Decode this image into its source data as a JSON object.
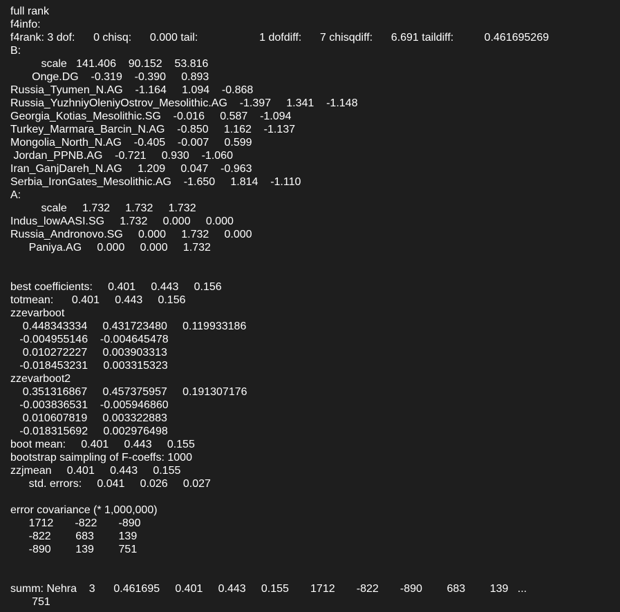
{
  "lines": [
    "full rank",
    "f4info:",
    "f4rank: 3 dof:      0 chisq:      0.000 tail:                    1 dofdiff:      7 chisqdiff:      6.691 taildiff:          0.461695269",
    "B:",
    "          scale   141.406    90.152    53.816",
    "       Onge.DG    -0.319    -0.390     0.893",
    "Russia_Tyumen_N.AG    -1.164     1.094    -0.868",
    "Russia_YuzhniyOleniyOstrov_Mesolithic.AG    -1.397     1.341    -1.148",
    "Georgia_Kotias_Mesolithic.SG    -0.016     0.587    -1.094",
    "Turkey_Marmara_Barcin_N.AG    -0.850     1.162    -1.137",
    "Mongolia_North_N.AG    -0.405    -0.007     0.599",
    " Jordan_PPNB.AG    -0.721     0.930    -1.060",
    "Iran_GanjDareh_N.AG     1.209     0.047    -0.963",
    "Serbia_IronGates_Mesolithic.AG    -1.650     1.814    -1.110",
    "A:",
    "          scale     1.732     1.732     1.732",
    "Indus_lowAASI.SG     1.732     0.000     0.000",
    "Russia_Andronovo.SG     0.000     1.732     0.000",
    "      Paniya.AG     0.000     0.000     1.732",
    "",
    "",
    "best coefficients:     0.401     0.443     0.156",
    "totmean:      0.401     0.443     0.156",
    "zzevarboot",
    "    0.448343334     0.431723480     0.119933186",
    "   -0.004955146    -0.004645478",
    "    0.010272227     0.003903313",
    "   -0.018453231     0.003315323",
    "zzevarboot2",
    "    0.351316867     0.457375957     0.191307176",
    "   -0.003836531    -0.005946860",
    "    0.010607819     0.003322883",
    "   -0.018315692     0.002976498",
    "boot mean:     0.401     0.443     0.155",
    "bootstrap saimpling of F-coeffs: 1000",
    "zzjmean     0.401     0.443     0.155",
    "      std. errors:     0.041     0.026     0.027",
    "",
    "error covariance (* 1,000,000)",
    "      1712       -822       -890",
    "      -822        683        139",
    "      -890        139        751",
    "",
    "",
    "summ: Nehra    3      0.461695     0.401     0.443     0.155       1712       -822       -890        683        139   ...",
    "       751"
  ]
}
